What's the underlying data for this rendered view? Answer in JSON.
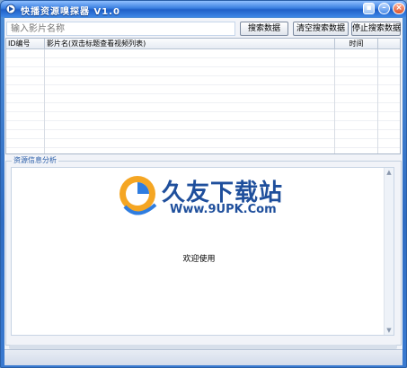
{
  "window": {
    "title": "快播资源嗅探器 V1.0"
  },
  "search": {
    "placeholder": "输入影片名称",
    "search_label": "搜索数据",
    "clear_label": "清空搜索数据",
    "stop_label": "停止搜索数据"
  },
  "table": {
    "columns": [
      "ID编号",
      "影片名(双击标题查看视频列表)",
      "时间",
      ""
    ],
    "rows": []
  },
  "info": {
    "group_label": "资源信息分析",
    "welcome": "欢迎使用"
  },
  "watermark": {
    "name": "久友下载站",
    "url": "Www.9UPK.Com"
  },
  "colors": {
    "titlebar": "#2f6cc2",
    "accent_text": "#2d67c6",
    "logo": "#1f4f9c"
  }
}
